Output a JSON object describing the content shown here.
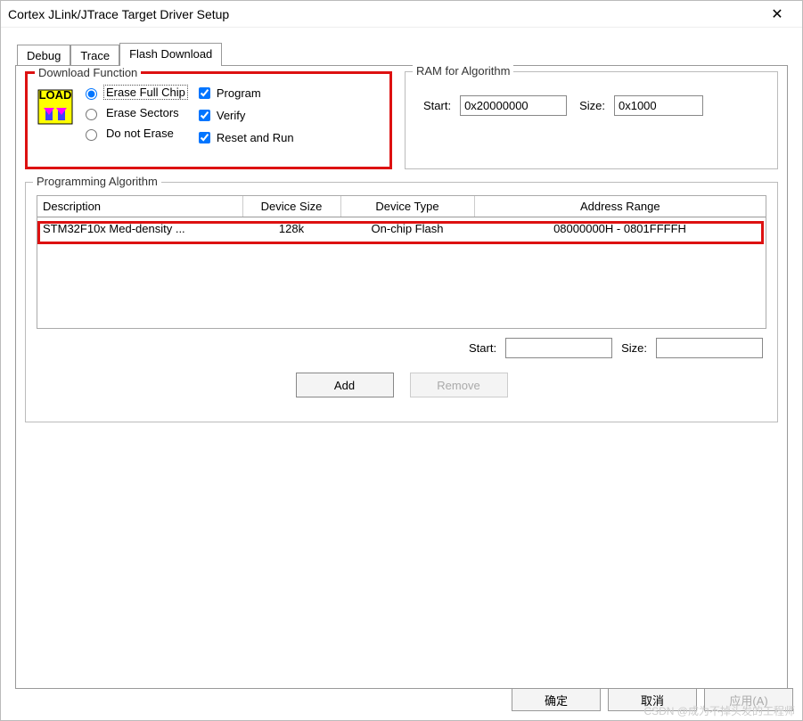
{
  "window": {
    "title": "Cortex JLink/JTrace Target Driver Setup"
  },
  "tabs": {
    "debug": "Debug",
    "trace": "Trace",
    "flash": "Flash Download"
  },
  "download": {
    "legend": "Download Function",
    "radios": {
      "erase_full": "Erase Full Chip",
      "erase_sectors": "Erase Sectors",
      "do_not_erase": "Do not Erase"
    },
    "checks": {
      "program": "Program",
      "verify": "Verify",
      "reset_run": "Reset and Run"
    }
  },
  "ram": {
    "legend": "RAM for Algorithm",
    "start_label": "Start:",
    "start_value": "0x20000000",
    "size_label": "Size:",
    "size_value": "0x1000"
  },
  "prog": {
    "legend": "Programming Algorithm",
    "headers": {
      "desc": "Description",
      "size": "Device Size",
      "type": "Device Type",
      "range": "Address Range"
    },
    "rows": [
      {
        "desc": "STM32F10x Med-density ...",
        "size": "128k",
        "type": "On-chip Flash",
        "range": "08000000H - 0801FFFFH"
      }
    ],
    "start_label": "Start:",
    "start_value": "",
    "size_label": "Size:",
    "size_value": "",
    "add": "Add",
    "remove": "Remove"
  },
  "footer": {
    "ok": "确定",
    "cancel": "取消",
    "apply": "应用(A)"
  },
  "watermark": "CSDN @成为不掉头发的工程师"
}
